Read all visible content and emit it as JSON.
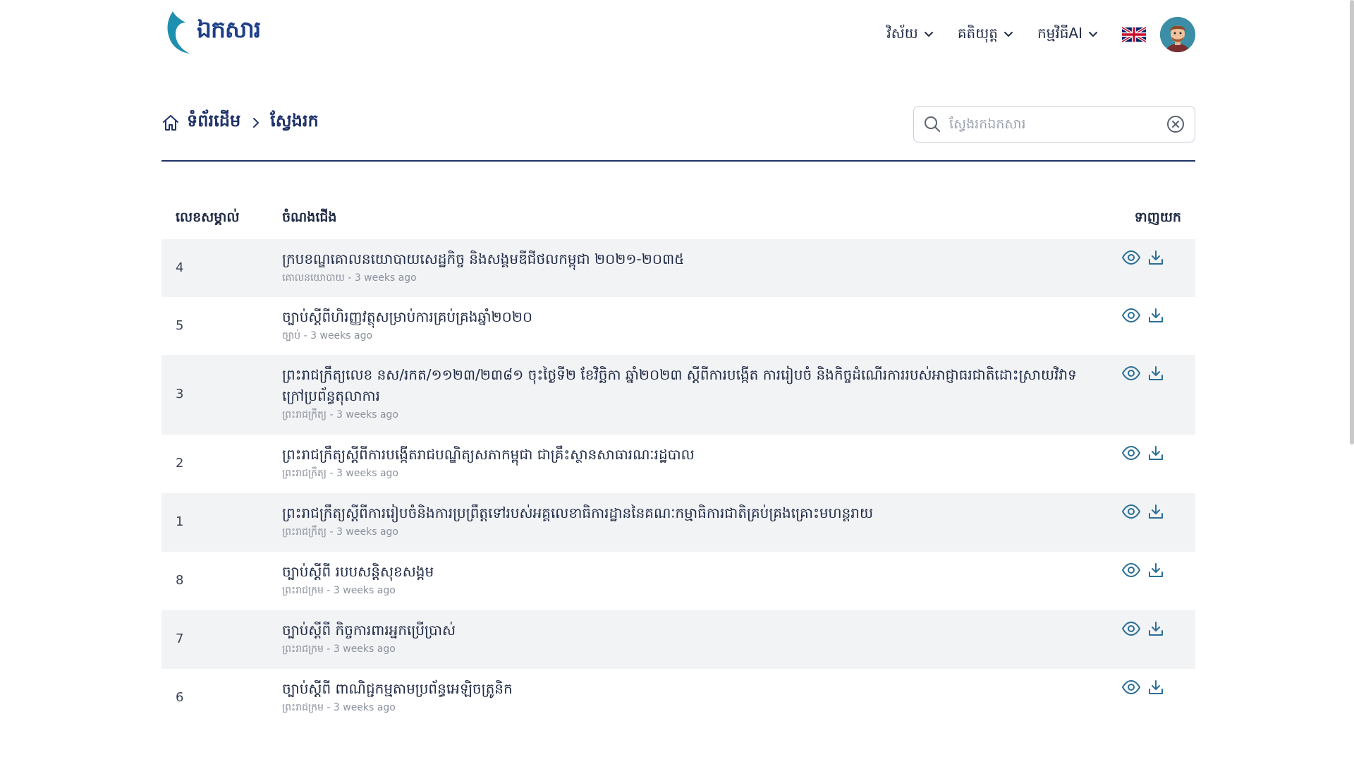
{
  "header": {
    "logo_text": "ឯកសារ",
    "nav": [
      {
        "label": "វិស័យ"
      },
      {
        "label": "គតិយុត្ត"
      },
      {
        "label": "កម្មវិធីAI"
      }
    ],
    "language_icon": "uk-flag-icon",
    "avatar_icon": "user-avatar"
  },
  "breadcrumb": {
    "home": "ទំព័រដើម",
    "current": "ស្វែងរក"
  },
  "search": {
    "placeholder": "ស្វែងរកឯកសារ",
    "value": ""
  },
  "table": {
    "headers": {
      "id": "លេខសម្គាល់",
      "title": "ចំណងជើង",
      "download": "ទាញយក"
    },
    "rows": [
      {
        "id": "4",
        "title": "ក្របខណ្ឌគោលនយោបាយសេដ្ឋកិច្ច និងសង្គមឌីជីថលកម្ពុជា ២០២១-២០៣៥",
        "category": "គោលនយោបាយ",
        "time": "3 weeks ago"
      },
      {
        "id": "5",
        "title": "ច្បាប់ស្តីពីហិរញ្ញវត្ថុសម្រាប់ការគ្រប់គ្រងឆ្នាំ២០២០",
        "category": "ច្បាប់",
        "time": "3 weeks ago"
      },
      {
        "id": "3",
        "title": "ព្រះរាជក្រឹត្យលេខ នស/រកត/១១២៣/២៣៨១ ចុះថ្ងៃទី២ ខែវិច្ឆិកា ឆ្នាំ២០២៣ ស្តីពីការបង្កើត ការរៀបចំ និងកិច្ចដំណើរការរបស់អាជ្ញាធរជាតិដោះស្រាយវិវាទក្រៅប្រព័ន្ធតុលាការ",
        "category": "ព្រះរាជក្រឹត្យ",
        "time": "3 weeks ago"
      },
      {
        "id": "2",
        "title": "ព្រះរាជក្រឹត្យស្តីពីការបង្កើតរាជបណ្ឌិត្យសភាកម្ពុជា ជាគ្រឹះស្ថានសាធារណៈរដ្ឋបាល",
        "category": "ព្រះរាជក្រឹត្យ",
        "time": "3 weeks ago"
      },
      {
        "id": "1",
        "title": "ព្រះរាជក្រឹត្យស្តីពីការរៀបចំនិងការប្រព្រឹត្តទៅរបស់អគ្គលេខាធិការដ្ឋាននៃគណៈកម្មាធិការជាតិគ្រប់គ្រងគ្រោះមហន្តរាយ",
        "category": "ព្រះរាជក្រឹត្យ",
        "time": "3 weeks ago"
      },
      {
        "id": "8",
        "title": "ច្បាប់ស្តីពី របបសន្តិសុខសង្គម",
        "category": "ព្រះរាជក្រម",
        "time": "3 weeks ago"
      },
      {
        "id": "7",
        "title": "ច្បាប់ស្តីពី កិច្ចការពារអ្នកប្រើប្រាស់",
        "category": "ព្រះរាជក្រម",
        "time": "3 weeks ago"
      },
      {
        "id": "6",
        "title": "ច្បាប់ស្តីពី ពាណិជ្ជកម្មតាមប្រព័ន្ធអេឡិចត្រូនិក",
        "category": "ព្រះរាជក្រម",
        "time": "3 weeks ago"
      }
    ]
  },
  "colors": {
    "primary": "#1f3269",
    "accent": "#2a6f97",
    "row_shade": "#f2f3f5"
  }
}
